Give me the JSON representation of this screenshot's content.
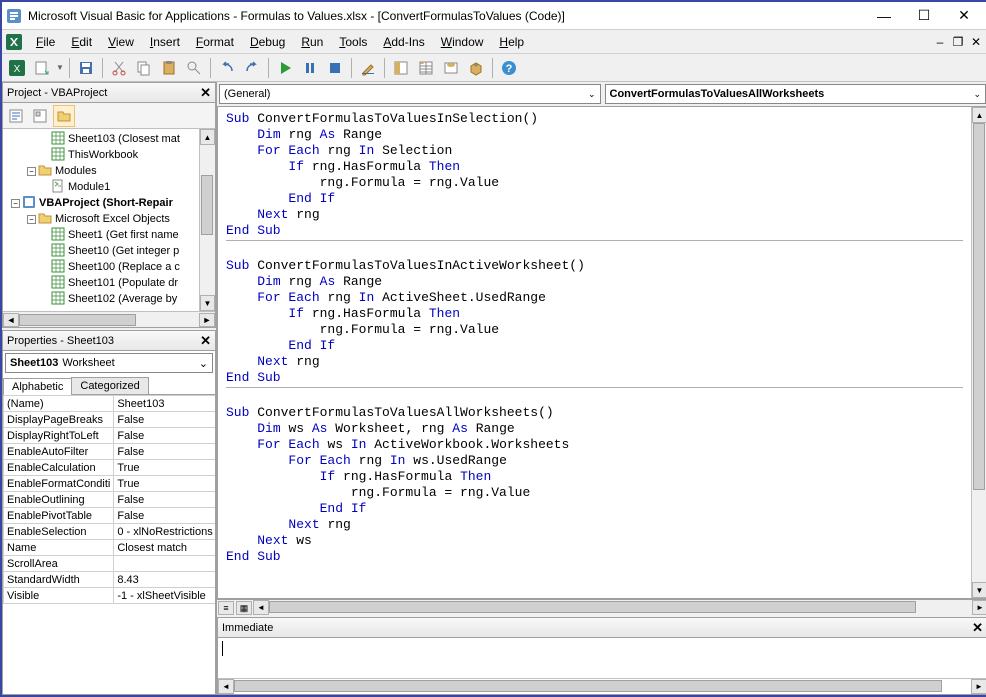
{
  "window": {
    "title": "Microsoft Visual Basic for Applications - Formulas to Values.xlsx - [ConvertFormulasToValues (Code)]"
  },
  "menus": [
    "File",
    "Edit",
    "View",
    "Insert",
    "Format",
    "Debug",
    "Run",
    "Tools",
    "Add-Ins",
    "Window",
    "Help"
  ],
  "project_panel": {
    "title": "Project - VBAProject",
    "tree": [
      {
        "indent": 48,
        "icon": "sheet",
        "label": "Sheet103 (Closest mat",
        "bold": false
      },
      {
        "indent": 48,
        "icon": "sheet",
        "label": "ThisWorkbook",
        "bold": false
      },
      {
        "indent": 24,
        "icon": "folder-open",
        "label": "Modules",
        "bold": false,
        "expander": "-"
      },
      {
        "indent": 48,
        "icon": "module",
        "label": "Module1",
        "bold": false
      },
      {
        "indent": 8,
        "icon": "vba",
        "label": "VBAProject (Short-Repair",
        "bold": true,
        "expander": "-"
      },
      {
        "indent": 24,
        "icon": "folder-open",
        "label": "Microsoft Excel Objects",
        "bold": false,
        "expander": "-"
      },
      {
        "indent": 48,
        "icon": "sheet",
        "label": "Sheet1 (Get first name",
        "bold": false
      },
      {
        "indent": 48,
        "icon": "sheet",
        "label": "Sheet10 (Get integer p",
        "bold": false
      },
      {
        "indent": 48,
        "icon": "sheet",
        "label": "Sheet100 (Replace a c",
        "bold": false
      },
      {
        "indent": 48,
        "icon": "sheet",
        "label": "Sheet101 (Populate dr",
        "bold": false
      },
      {
        "indent": 48,
        "icon": "sheet",
        "label": "Sheet102 (Average by",
        "bold": false
      }
    ]
  },
  "properties_panel": {
    "title": "Properties - Sheet103",
    "object_name": "Sheet103",
    "object_type": "Worksheet",
    "tabs": [
      "Alphabetic",
      "Categorized"
    ],
    "active_tab": 0,
    "rows": [
      {
        "name": "(Name)",
        "value": "Sheet103"
      },
      {
        "name": "DisplayPageBreaks",
        "value": "False"
      },
      {
        "name": "DisplayRightToLeft",
        "value": "False"
      },
      {
        "name": "EnableAutoFilter",
        "value": "False"
      },
      {
        "name": "EnableCalculation",
        "value": "True"
      },
      {
        "name": "EnableFormatConditi",
        "value": "True"
      },
      {
        "name": "EnableOutlining",
        "value": "False"
      },
      {
        "name": "EnablePivotTable",
        "value": "False"
      },
      {
        "name": "EnableSelection",
        "value": "0 - xlNoRestrictions"
      },
      {
        "name": "Name",
        "value": "Closest match"
      },
      {
        "name": "ScrollArea",
        "value": ""
      },
      {
        "name": "StandardWidth",
        "value": "8.43"
      },
      {
        "name": "Visible",
        "value": "-1 - xlSheetVisible"
      }
    ]
  },
  "code_header": {
    "left_combo": "(General)",
    "right_combo": "ConvertFormulasToValuesAllWorksheets"
  },
  "code_lines": [
    {
      "t": "Sub ",
      "k": true,
      "r": "ConvertFormulasToValuesInSelection()"
    },
    {
      "i": 4,
      "t": "Dim ",
      "k": true,
      "r": "rng ",
      "t2": "As ",
      "k2": true,
      "r2": "Range"
    },
    {
      "i": 4,
      "t": "For Each ",
      "k": true,
      "r": "rng ",
      "t2": "In ",
      "k2": true,
      "r2": "Selection"
    },
    {
      "i": 8,
      "t": "If ",
      "k": true,
      "r": "rng.HasFormula ",
      "t2": "Then",
      "k2": true
    },
    {
      "i": 12,
      "r": "rng.Formula = rng.Value"
    },
    {
      "i": 8,
      "t": "End If",
      "k": true
    },
    {
      "i": 4,
      "t": "Next ",
      "k": true,
      "r": "rng"
    },
    {
      "t": "End Sub",
      "k": true
    },
    {
      "div": true
    },
    {
      "t": "Sub ",
      "k": true,
      "r": "ConvertFormulasToValuesInActiveWorksheet()"
    },
    {
      "i": 4,
      "t": "Dim ",
      "k": true,
      "r": "rng ",
      "t2": "As ",
      "k2": true,
      "r2": "Range"
    },
    {
      "i": 4,
      "t": "For Each ",
      "k": true,
      "r": "rng ",
      "t2": "In ",
      "k2": true,
      "r2": "ActiveSheet.UsedRange"
    },
    {
      "i": 8,
      "t": "If ",
      "k": true,
      "r": "rng.HasFormula ",
      "t2": "Then",
      "k2": true
    },
    {
      "i": 12,
      "r": "rng.Formula = rng.Value"
    },
    {
      "i": 8,
      "t": "End If",
      "k": true
    },
    {
      "i": 4,
      "t": "Next ",
      "k": true,
      "r": "rng"
    },
    {
      "t": "End Sub",
      "k": true
    },
    {
      "div": true
    },
    {
      "t": "Sub ",
      "k": true,
      "r": "ConvertFormulasToValuesAllWorksheets()"
    },
    {
      "i": 4,
      "t": "Dim ",
      "k": true,
      "r": "ws ",
      "t2": "As ",
      "k2": true,
      "r2": "Worksheet, rng ",
      "t3": "As ",
      "k3": true,
      "r3": "Range"
    },
    {
      "i": 4,
      "t": "For Each ",
      "k": true,
      "r": "ws ",
      "t2": "In ",
      "k2": true,
      "r2": "ActiveWorkbook.Worksheets"
    },
    {
      "i": 8,
      "t": "For Each ",
      "k": true,
      "r": "rng ",
      "t2": "In ",
      "k2": true,
      "r2": "ws.UsedRange"
    },
    {
      "i": 12,
      "t": "If ",
      "k": true,
      "r": "rng.HasFormula ",
      "t2": "Then",
      "k2": true
    },
    {
      "i": 16,
      "r": "rng.Formula = rng.Value"
    },
    {
      "i": 12,
      "t": "End If",
      "k": true
    },
    {
      "i": 8,
      "t": "Next ",
      "k": true,
      "r": "rng"
    },
    {
      "i": 4,
      "t": "Next ",
      "k": true,
      "r": "ws"
    },
    {
      "t": "End Sub",
      "k": true
    }
  ],
  "immediate": {
    "title": "Immediate"
  }
}
